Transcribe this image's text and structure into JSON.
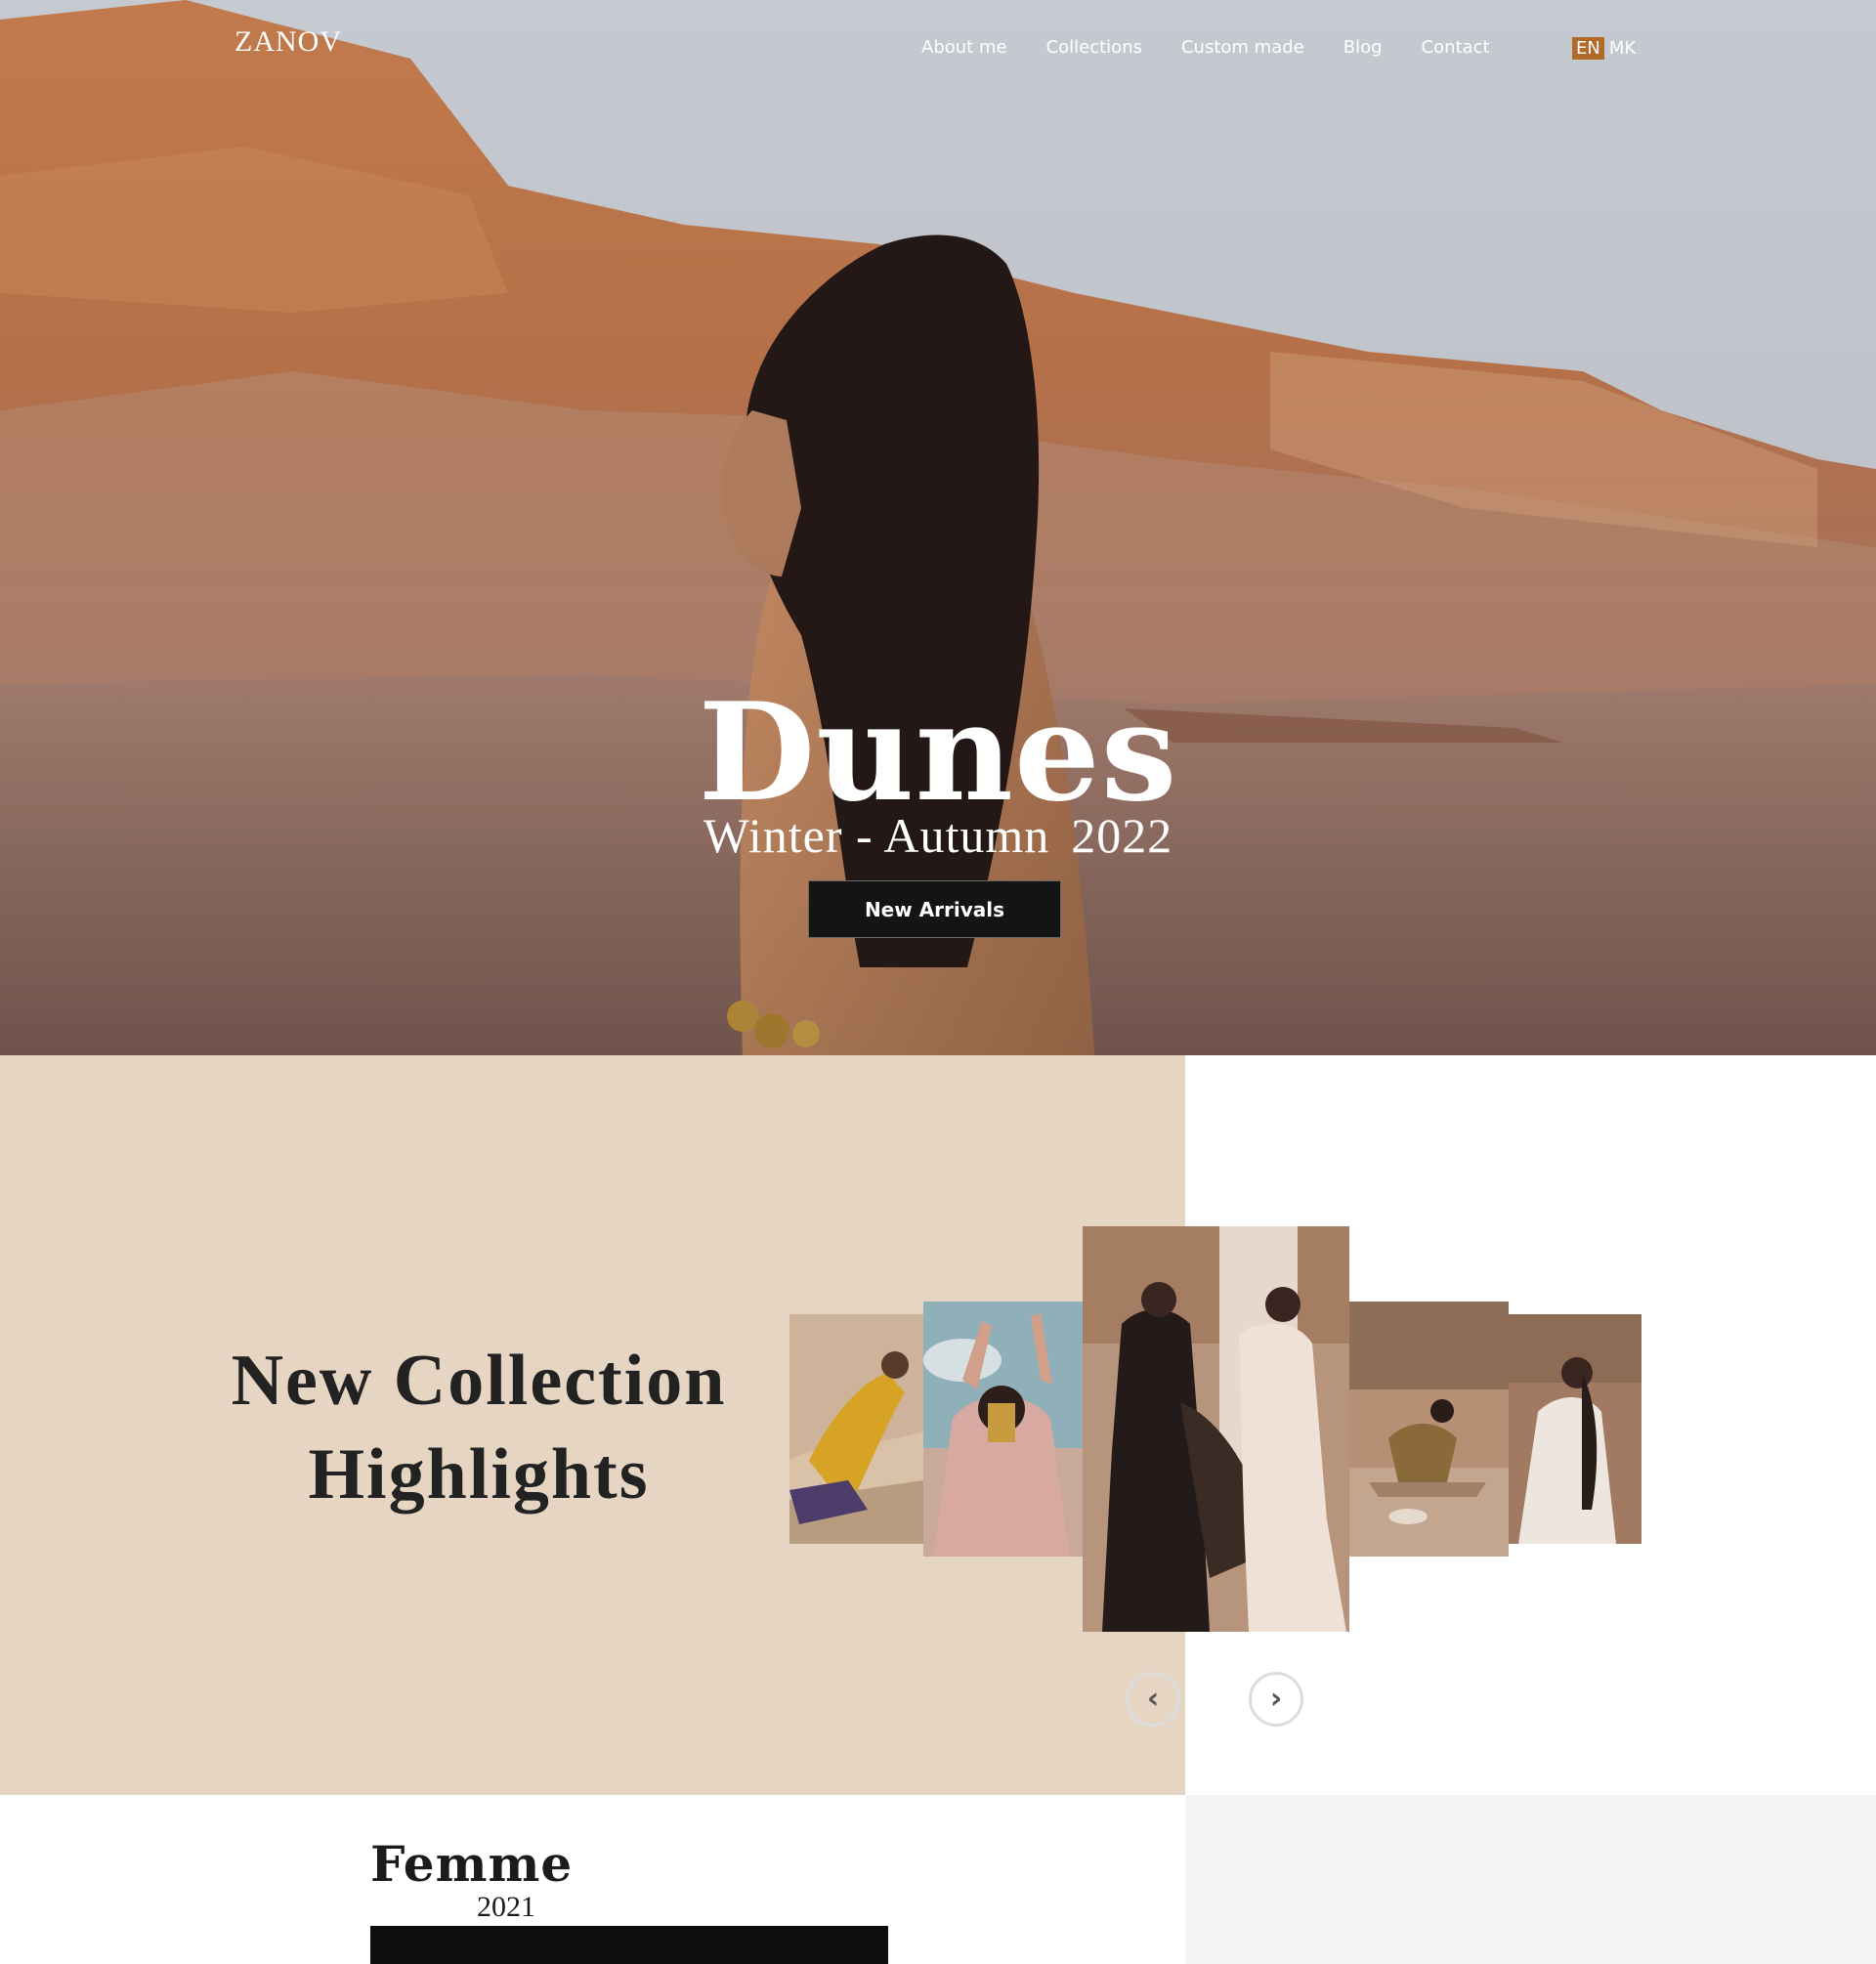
{
  "brand": {
    "logo": "ZANOV"
  },
  "nav": {
    "items": [
      {
        "label": "About me"
      },
      {
        "label": "Collections"
      },
      {
        "label": "Custom made"
      },
      {
        "label": "Blog"
      },
      {
        "label": "Contact"
      }
    ]
  },
  "language": {
    "active": "EN",
    "other": "MK",
    "accent_color": "#b26a28"
  },
  "hero": {
    "title": "Dunes",
    "subtitle": "Winter - Autumn",
    "year": "2022",
    "cta_label": "New Arrivals"
  },
  "highlights": {
    "title_line1": "New Collection",
    "title_line2": "Highlights",
    "background_color": "#e6d5c3",
    "prev_icon": "chevron-left-icon",
    "next_icon": "chevron-right-icon"
  },
  "collection": {
    "name": "Femme",
    "year": "2021"
  }
}
